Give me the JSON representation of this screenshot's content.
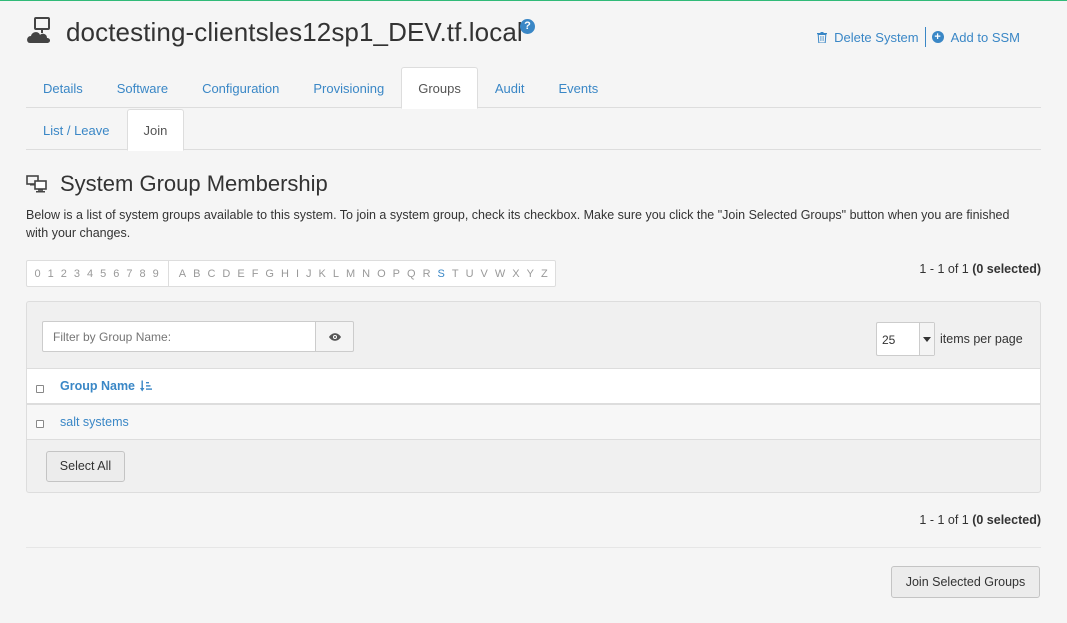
{
  "header": {
    "title": "doctesting-clientsles12sp1_DEV.tf.local",
    "help_icon": "?",
    "delete_label": "Delete System",
    "ssm_label": "Add to SSM",
    "sys_icon": "system-cloud-icon"
  },
  "tabs": [
    {
      "label": "Details",
      "active": false
    },
    {
      "label": "Software",
      "active": false
    },
    {
      "label": "Configuration",
      "active": false
    },
    {
      "label": "Provisioning",
      "active": false
    },
    {
      "label": "Groups",
      "active": true
    },
    {
      "label": "Audit",
      "active": false
    },
    {
      "label": "Events",
      "active": false
    }
  ],
  "subtabs": [
    {
      "label": "List / Leave",
      "active": false
    },
    {
      "label": "Join",
      "active": true
    }
  ],
  "section": {
    "title": "System Group Membership",
    "description": "Below is a list of system groups available to this system. To join a system group, check its checkbox. Make sure you click the \"Join Selected Groups\" button when you are finished with your changes."
  },
  "alphabar": {
    "digits": [
      "0",
      "1",
      "2",
      "3",
      "4",
      "5",
      "6",
      "7",
      "8",
      "9"
    ],
    "letters": [
      "A",
      "B",
      "C",
      "D",
      "E",
      "F",
      "G",
      "H",
      "I",
      "J",
      "K",
      "L",
      "M",
      "N",
      "O",
      "P",
      "Q",
      "R",
      "S",
      "T",
      "U",
      "V",
      "W",
      "X",
      "Y",
      "Z"
    ],
    "active": "S"
  },
  "pager": {
    "range": "1 - 1 of 1",
    "selected": "(0 selected)"
  },
  "filter": {
    "placeholder": "Filter by Group Name:"
  },
  "perpage": {
    "value": "25",
    "label": "items per page"
  },
  "table": {
    "column": "Group Name",
    "rows": [
      "salt systems"
    ]
  },
  "buttons": {
    "select_all": "Select All",
    "join": "Join Selected Groups"
  },
  "colors": {
    "accent": "#3a87c6",
    "top_border": "#30ba78"
  }
}
